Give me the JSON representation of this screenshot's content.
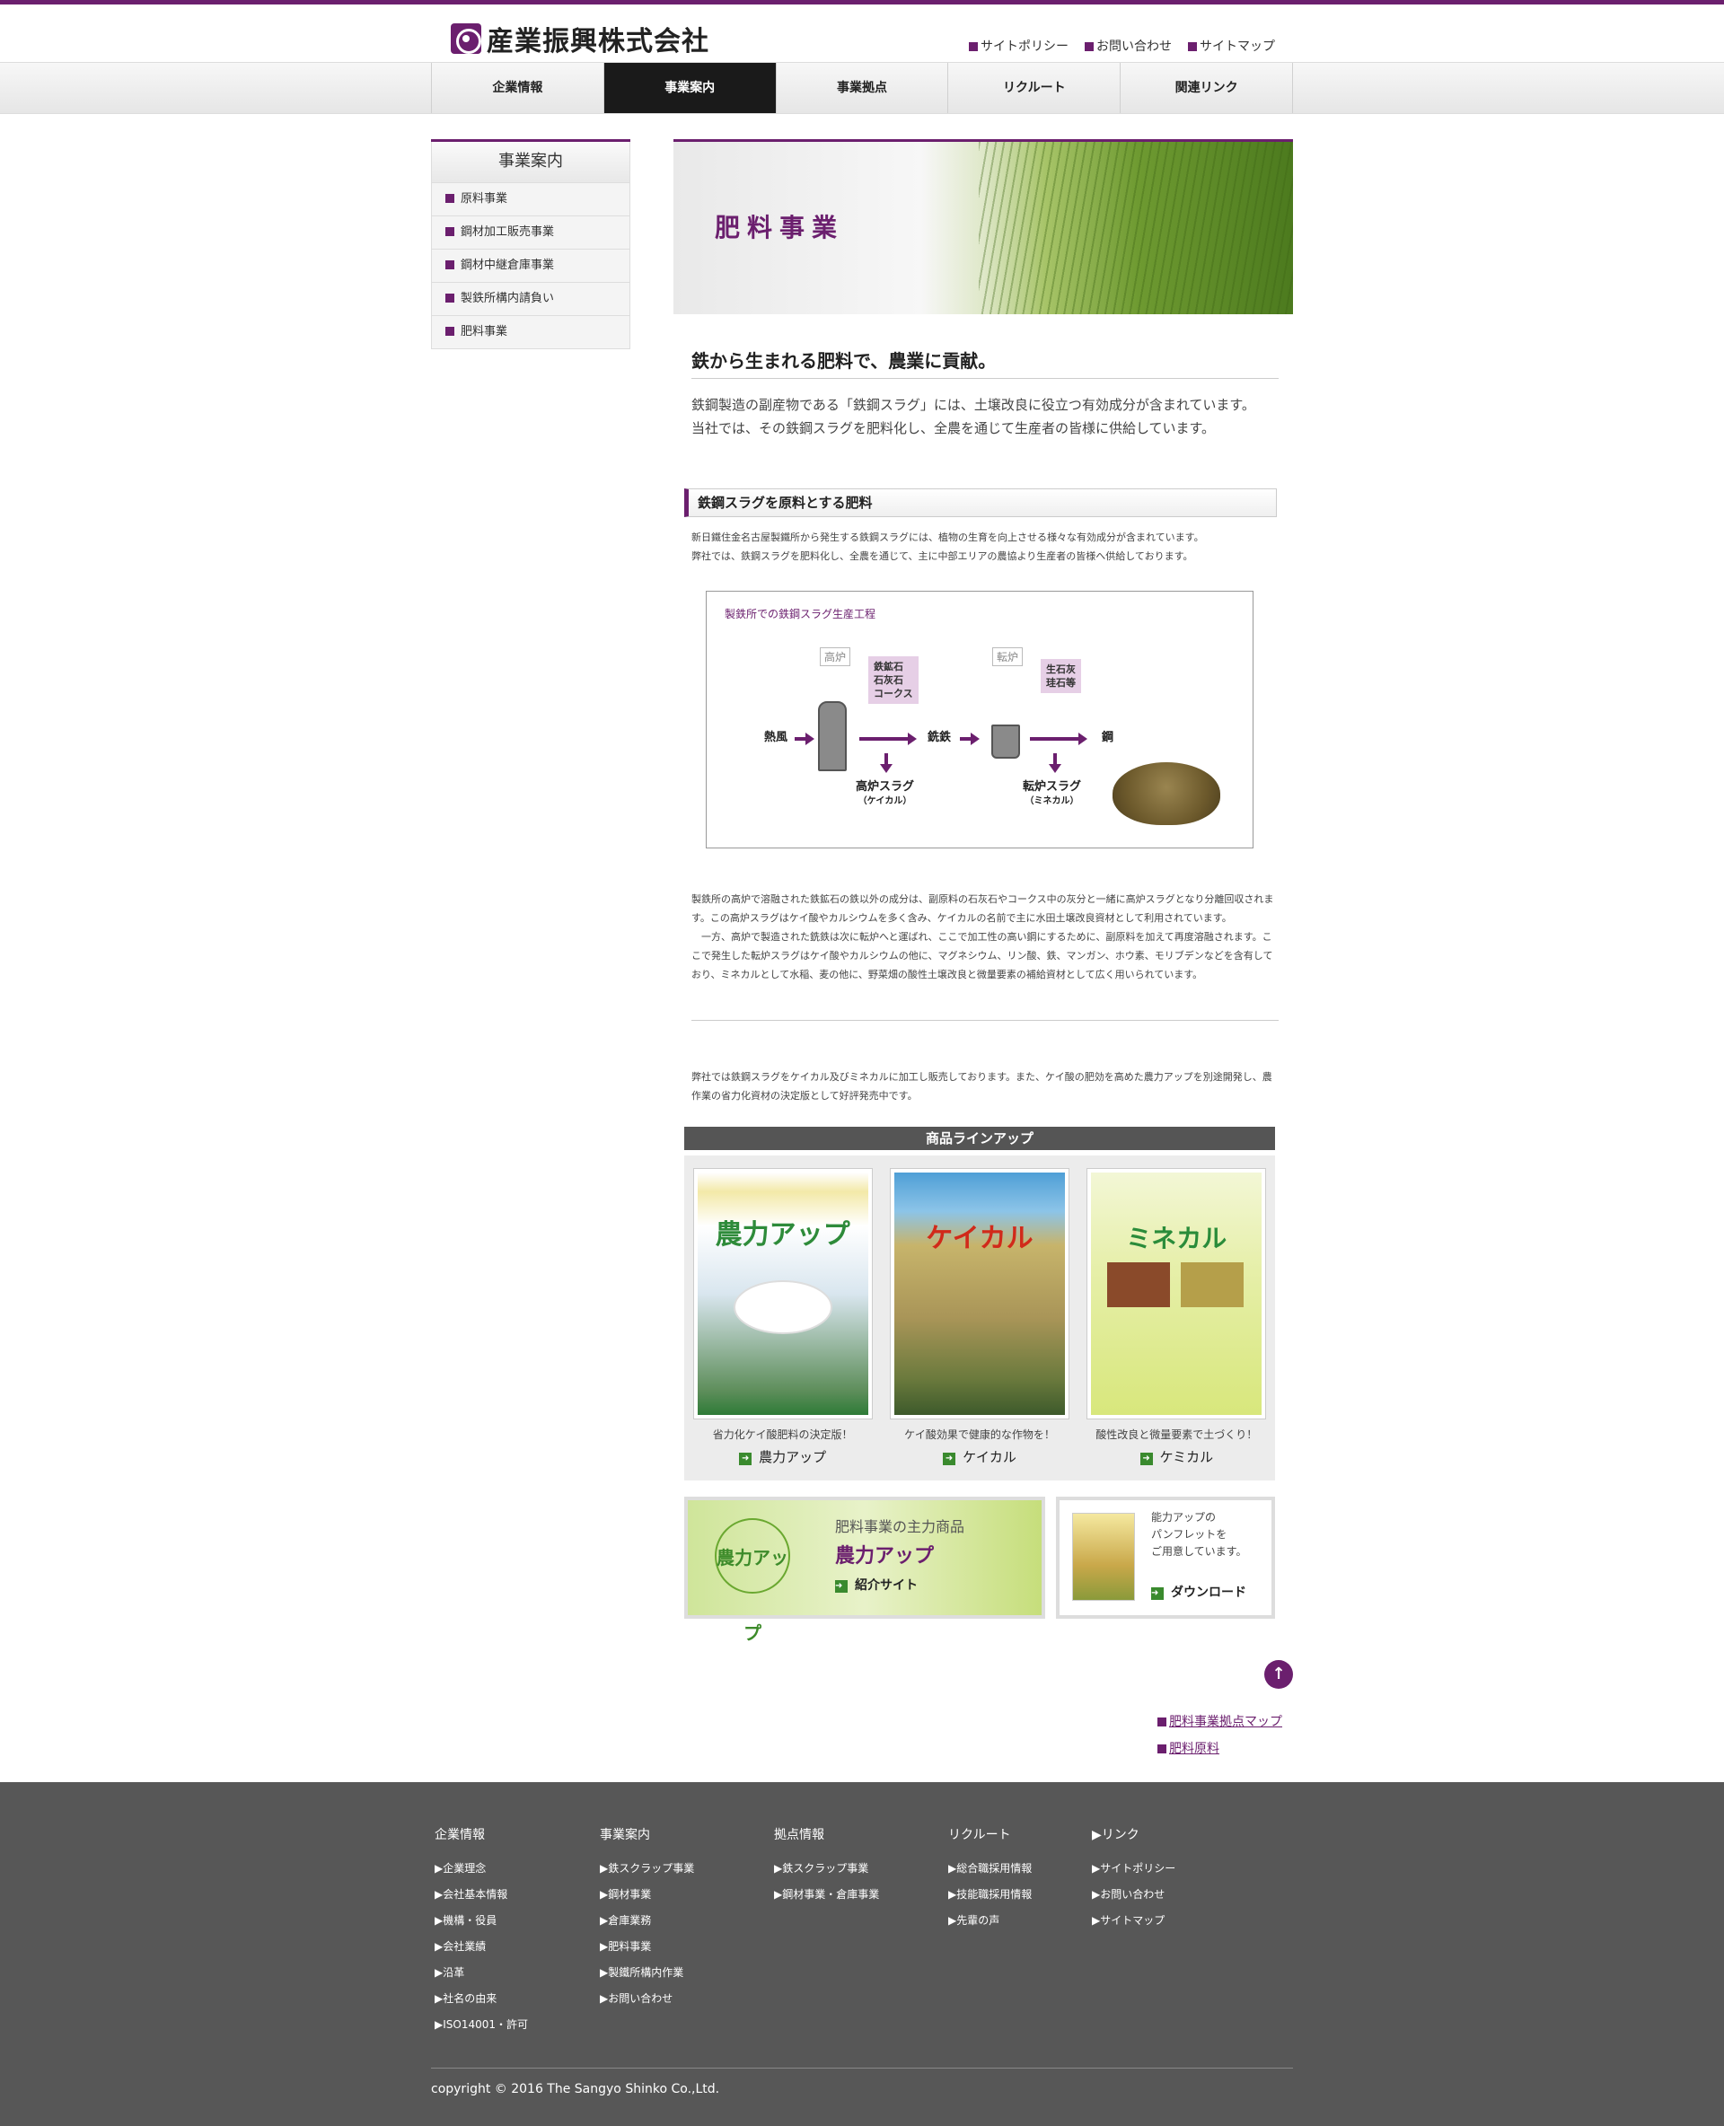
{
  "header": {
    "company_name": "産業振興株式会社",
    "util_links": [
      "サイトポリシー",
      "お問い合わせ",
      "サイトマップ"
    ]
  },
  "nav": [
    "企業情報",
    "事業案内",
    "事業拠点",
    "リクルート",
    "関連リンク"
  ],
  "sidebar": {
    "title": "事業案内",
    "items": [
      "原料事業",
      "鋼材加工販売事業",
      "鋼材中継倉庫事業",
      "製鉄所構内請負い",
      "肥料事業"
    ]
  },
  "banner": {
    "title": "肥料事業"
  },
  "lead": {
    "heading": "鉄から生まれる肥料で、農業に貢献。",
    "line1": "鉄鋼製造の副産物である「鉄鋼スラグ」には、土壌改良に役立つ有効成分が含まれています。",
    "line2": "当社では、その鉄鋼スラグを肥料化し、全農を通じて生産者の皆様に供給しています。"
  },
  "section": {
    "heading": "鉄鋼スラグを原料とする肥料",
    "intro1": "新日鐵住金名古屋製鐵所から発生する鉄鋼スラグには、植物の生育を向上させる様々な有効成分が含まれています。",
    "intro2": "弊社では、鉄鋼スラグを肥料化し、全農を通じて、主に中部エリアの農協より生産者の皆様へ供給しております。"
  },
  "diagram": {
    "title": "製鉄所での鉄鋼スラグ生産工程",
    "blast_furnace": "高炉",
    "converter": "転炉",
    "materials1": [
      "鉄鉱石",
      "石灰石",
      "コークス"
    ],
    "materials2": [
      "生石灰",
      "珪石等"
    ],
    "hot_air": "熱風",
    "pig_iron": "銑鉄",
    "steel": "鋼",
    "slag1": "高炉スラグ",
    "slag1_sub": "（ケイカル）",
    "slag2": "転炉スラグ",
    "slag2_sub": "（ミネカル）"
  },
  "body": {
    "p1": "製鉄所の高炉で溶融された鉄鉱石の鉄以外の成分は、副原料の石灰石やコークス中の灰分と一緒に高炉スラグとなり分離回収されます。この高炉スラグはケイ酸やカルシウムを多く含み、ケイカルの名前で主に水田土壌改良資材として利用されています。",
    "p2": "　一方、高炉で製造された銑鉄は次に転炉へと運ばれ、ここで加工性の高い鋼にするために、副原料を加えて再度溶融されます。ここで発生した転炉スラグはケイ酸やカルシウムの他に、マグネシウム、リン酸、鉄、マンガン、ホウ素、モリブデンなどを含有しており、ミネカルとして水稲、麦の他に、野菜畑の酸性土壌改良と微量要素の補給資材として広く用いられています。",
    "p3": "弊社では鉄鋼スラグをケイカル及びミネカルに加工し販売しております。また、ケイ酸の肥効を高めた農力アップを別途開発し、農作業の省力化資材の決定版として好評発売中です。"
  },
  "lineup": {
    "heading": "商品ラインアップ",
    "products": [
      {
        "image_title": "農力アップ",
        "caption": "省力化ケイ酸肥料の決定版！",
        "name": "農力アップ"
      },
      {
        "image_title": "ケイカル",
        "caption": "ケイ酸効果で健康的な作物を！",
        "name": "ケイカル"
      },
      {
        "image_title": "ミネカル",
        "caption": "酸性改良と微量要素で土づくり！",
        "name": "ケミカル"
      }
    ]
  },
  "promo": {
    "logo": "農力アップ",
    "sub": "肥料事業の主力商品",
    "title": "農力アップ",
    "link": "紹介サイト",
    "pamphlet_l1": "能力アップの",
    "pamphlet_l2": "パンフレットを",
    "pamphlet_l3": "ご用意しています。",
    "download": "ダウンロード"
  },
  "bottom_links": [
    "肥料事業拠点マップ",
    "肥料原料"
  ],
  "footer": {
    "cols": [
      {
        "title": "企業情報",
        "items": [
          "▶企業理念",
          "▶会社基本情報",
          "▶機構・役員",
          "▶会社業績",
          "▶沿革",
          "▶社名の由来",
          "▶ISO14001・許可"
        ]
      },
      {
        "title": "事業案内",
        "items": [
          "▶鉄スクラップ事業",
          "▶鋼材事業",
          "▶倉庫業務",
          "▶肥料事業",
          "▶製鐵所構内作業",
          "▶お問い合わせ"
        ]
      },
      {
        "title": "拠点情報",
        "items": [
          "▶鉄スクラップ事業",
          "▶鋼材事業・倉庫事業"
        ]
      },
      {
        "title": "リクルート",
        "items": [
          "▶総合職採用情報",
          "▶技能職採用情報",
          "▶先輩の声"
        ]
      },
      {
        "title": "▶リンク",
        "items": [
          "▶サイトポリシー",
          "▶お問い合わせ",
          "▶サイトマップ"
        ]
      }
    ],
    "copyright": "copyright © 2016 The Sangyo Shinko Co.,Ltd."
  },
  "colors": {
    "brand": "#6b1f6e",
    "nav_active": "#1a1a1a",
    "footer": "#575757",
    "green": "#3a8a2e"
  }
}
